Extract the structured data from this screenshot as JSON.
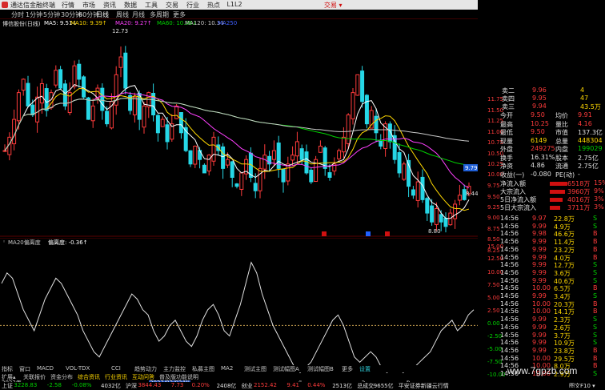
{
  "window": {
    "title": "通达信金融终端",
    "menu": [
      "行情",
      "市场",
      "资讯",
      "数据",
      "工具",
      "交易",
      "行业",
      "热点",
      "L1L2"
    ],
    "brand": "交易 ▾",
    "win_buttons": [
      "─",
      "□",
      "✕"
    ]
  },
  "periods": [
    {
      "label": "分时",
      "sel": false
    },
    {
      "label": "1分钟",
      "sel": false
    },
    {
      "label": "5分钟",
      "sel": false
    },
    {
      "label": "30分钟",
      "sel": false
    },
    {
      "label": "60分钟",
      "sel": false
    },
    {
      "label": "日线",
      "sel": true
    },
    {
      "label": "周线",
      "sel": false
    },
    {
      "label": "月线",
      "sel": false
    },
    {
      "label": "多周期",
      "sel": false
    },
    {
      "label": "更多",
      "sel": false
    }
  ],
  "ma_header": {
    "stock": "博信股份(日线)",
    "items": [
      {
        "text": "MA5: 9.51↓",
        "color": "#ffffff"
      },
      {
        "text": "MA10: 9.39↑",
        "color": "#ffd800"
      },
      {
        "text": "MA20: 9.27↑",
        "color": "#ff40ff"
      },
      {
        "text": "MA60: 10.08↓",
        "color": "#00d200"
      },
      {
        "text": "MA120: 10.3↓",
        "color": "#c8c8c8"
      },
      {
        "text": "MA250",
        "color": "#4060ff"
      }
    ]
  },
  "price_axis": [
    "11.75",
    "11.50",
    "11.25",
    "11.00",
    "10.75",
    "10.50",
    "10.25",
    "10.00",
    "9.75",
    "9.50",
    "9.25",
    "9.00",
    "8.75",
    "8.50",
    "8.25"
  ],
  "price_labels": {
    "high": "12.73",
    "low": "8.80",
    "now": "9.79",
    "marker": "8.44"
  },
  "osc_header": {
    "name": "MA20偏离度",
    "label": "偏离度: -0.36↑"
  },
  "osc_axis": [
    "15.00",
    "12.50",
    "10.00",
    "7.50",
    "5.00",
    "2.50",
    "0.00",
    "-2.50",
    "-5.00",
    "-7.50",
    "-10.00"
  ],
  "dates": {
    "left": "2022年",
    "mid": "2023/02/02/四",
    "m4": "4",
    "m5": "5",
    "m6": "6"
  },
  "tabs": [
    "指标",
    "窗口",
    "MACD",
    "VOL-TDX",
    "CCI",
    "趋势动力",
    "主力监控",
    "私募主图",
    "MA2",
    "测试主图",
    "测试幅图A",
    "测试幅图B",
    "更多",
    "设置"
  ],
  "tabs2": [
    "扩展▴",
    "关联报价",
    "资金分布",
    "综合资讯",
    "行业资讯",
    "互动问答",
    "普及版功能说明"
  ],
  "status": [
    {
      "text": "上证",
      "cls": "wht"
    },
    {
      "text": "3228.83",
      "cls": "grn"
    },
    {
      "text": "-2.58",
      "cls": "grn"
    },
    {
      "text": "-0.08%",
      "cls": "grn"
    },
    {
      "text": "4032亿",
      "cls": "wht"
    },
    {
      "text": "沪深",
      "cls": "wht"
    },
    {
      "text": "3844.43",
      "cls": "red"
    },
    {
      "text": "7.73",
      "cls": "red"
    },
    {
      "text": "0.20%",
      "cls": "red"
    },
    {
      "text": "2408亿",
      "cls": "wht"
    },
    {
      "text": "创业",
      "cls": "wht"
    },
    {
      "text": "2152.42",
      "cls": "red"
    },
    {
      "text": "9.41",
      "cls": "red"
    },
    {
      "text": "0.44%",
      "cls": "red"
    },
    {
      "text": "2513亿",
      "cls": "wht"
    },
    {
      "text": "总成交",
      "cls": "wht"
    },
    {
      "text": "9655亿",
      "cls": "wht"
    },
    {
      "text": "平安证券新疆云行情",
      "cls": "wht"
    }
  ],
  "quote": {
    "asks": [
      {
        "label": "卖二",
        "price": "9.96",
        "vol": "4"
      },
      {
        "label": "卖四",
        "price": "9.95",
        "vol": "47"
      },
      {
        "label": "卖三",
        "price": "9.94",
        "vol": "43.5万"
      }
    ],
    "stats": [
      {
        "l1": "今开",
        "v1": "9.50",
        "c1": "red",
        "l2": "均价",
        "v2": "9.91",
        "c2": "red"
      },
      {
        "l1": "最高",
        "v1": "10.25",
        "c1": "red",
        "l2": "量比",
        "v2": "4.16",
        "c2": "red"
      },
      {
        "l1": "最低",
        "v1": "9.50",
        "c1": "red",
        "l2": "市值",
        "v2": "137.3亿",
        "c2": "wht"
      },
      {
        "l1": "现量",
        "v1": "6149",
        "c1": "yel",
        "l2": "总量",
        "v2": "448304",
        "c2": "yel"
      },
      {
        "l1": "外盘",
        "v1": "249275",
        "c1": "red",
        "l2": "内盘",
        "v2": "199029",
        "c2": "grn"
      },
      {
        "l1": "换手",
        "v1": "16.31%",
        "c1": "wht",
        "l2": "股本",
        "v2": "2.75亿",
        "c2": "wht"
      },
      {
        "l1": "净资",
        "v1": "4.86",
        "c1": "wht",
        "l2": "流通",
        "v2": "2.75亿",
        "c2": "wht"
      },
      {
        "l1": "收益(一)",
        "v1": "-0.080",
        "c1": "wht",
        "l2": "PE(动)",
        "v2": "-",
        "c2": "wht"
      }
    ],
    "flows": [
      {
        "label": "净流入额",
        "value": "6518万",
        "pct": "15%"
      },
      {
        "label": "大宗流入",
        "value": "3960万",
        "pct": "9%"
      },
      {
        "label": "5日净流入额",
        "value": "4016万",
        "pct": "3%"
      },
      {
        "label": "5日大宗流入",
        "value": "3711万",
        "pct": "3%"
      }
    ],
    "ticks": [
      {
        "t": "14:56",
        "p": "9.97",
        "v": "22.8万",
        "s": "S"
      },
      {
        "t": "14:56",
        "p": "9.99",
        "v": "4.9万",
        "s": "S"
      },
      {
        "t": "14:56",
        "p": "9.98",
        "v": "46.6万",
        "s": "B"
      },
      {
        "t": "14:56",
        "p": "9.99",
        "v": "11.4万",
        "s": "B"
      },
      {
        "t": "14:56",
        "p": "9.99",
        "v": "23.2万",
        "s": "B"
      },
      {
        "t": "14:56",
        "p": "9.99",
        "v": "4.0万",
        "s": "B"
      },
      {
        "t": "14:56",
        "p": "9.99",
        "v": "12.7万",
        "s": "S"
      },
      {
        "t": "14:56",
        "p": "9.99",
        "v": "3.6万",
        "s": "S"
      },
      {
        "t": "14:56",
        "p": "9.99",
        "v": "40.6万",
        "s": "S"
      },
      {
        "t": "14:56",
        "p": "10.00",
        "v": "6.5万",
        "s": "B"
      },
      {
        "t": "14:56",
        "p": "9.99",
        "v": "3.4万",
        "s": "S"
      },
      {
        "t": "14:56",
        "p": "10.00",
        "v": "20.3万",
        "s": "B"
      },
      {
        "t": "14:56",
        "p": "10.00",
        "v": "14.1万",
        "s": "B"
      },
      {
        "t": "14:56",
        "p": "9.99",
        "v": "2.3万",
        "s": "S"
      },
      {
        "t": "14:56",
        "p": "9.99",
        "v": "2.6万",
        "s": "S"
      },
      {
        "t": "14:56",
        "p": "9.99",
        "v": "3.7万",
        "s": "S"
      },
      {
        "t": "14:56",
        "p": "9.99",
        "v": "10.9万",
        "s": "S"
      },
      {
        "t": "14:56",
        "p": "9.99",
        "v": "23.8万",
        "s": "B"
      },
      {
        "t": "14:56",
        "p": "10.00",
        "v": "29.5万",
        "s": "B"
      },
      {
        "t": "14:56",
        "p": "10.00",
        "v": "8.0万",
        "s": "B"
      },
      {
        "t": "14:56",
        "p": "10.00",
        "v": "2.9万",
        "s": "S"
      }
    ],
    "status_right": "图文F10 ▾"
  },
  "watermark": "www.7gpzb.com",
  "colors": {
    "up": "#ff3b3b",
    "down": "#26d7e6",
    "ma5": "#ffffff",
    "ma10": "#ffd800",
    "ma20": "#ff40ff",
    "ma60": "#00d200",
    "ma120": "#c8c8c8"
  }
}
